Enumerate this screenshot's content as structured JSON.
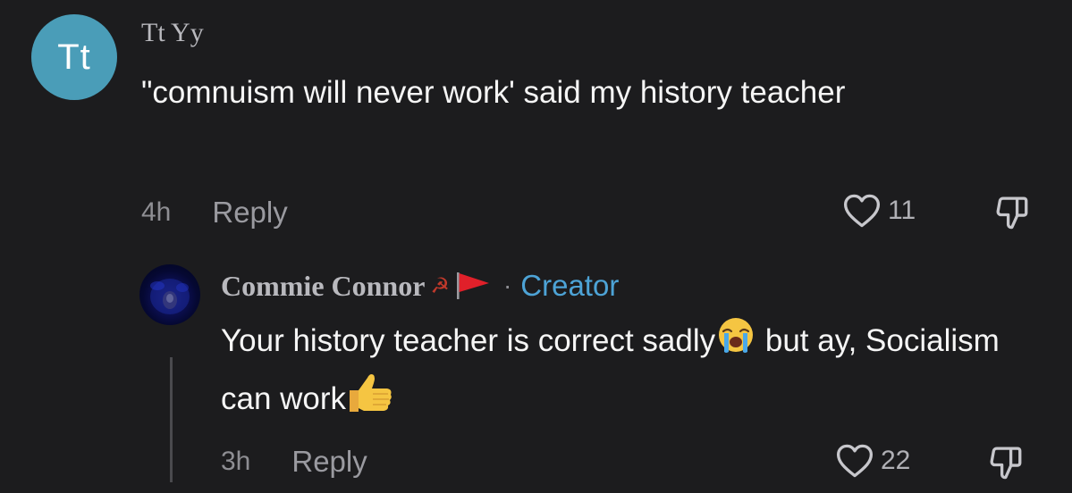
{
  "comment1": {
    "avatar_initials": "Tt",
    "avatar_color": "#4a9db8",
    "username": "Tt Yy",
    "text": "\"comnuism will never work' said my history teacher",
    "time": "4h",
    "reply_label": "Reply",
    "like_count": "11",
    "like_icon": "heart-outline-icon",
    "dislike_icon": "thumbs-down-icon"
  },
  "comment2": {
    "username": "Commie Connor",
    "badge_symbol": "☭",
    "flag_icon": "red-flag-icon",
    "separator": "·",
    "creator_label": "Creator",
    "creator_color": "#4da3d6",
    "text_part1": "Your history teacher is correct sadly",
    "emoji1": "loudly-crying-face-icon",
    "text_part2": " but ay, Socialism can work",
    "emoji2": "thumbs-up-icon",
    "time": "3h",
    "reply_label": "Reply",
    "like_count": "22",
    "like_icon": "heart-outline-icon",
    "dislike_icon": "thumbs-down-icon"
  }
}
